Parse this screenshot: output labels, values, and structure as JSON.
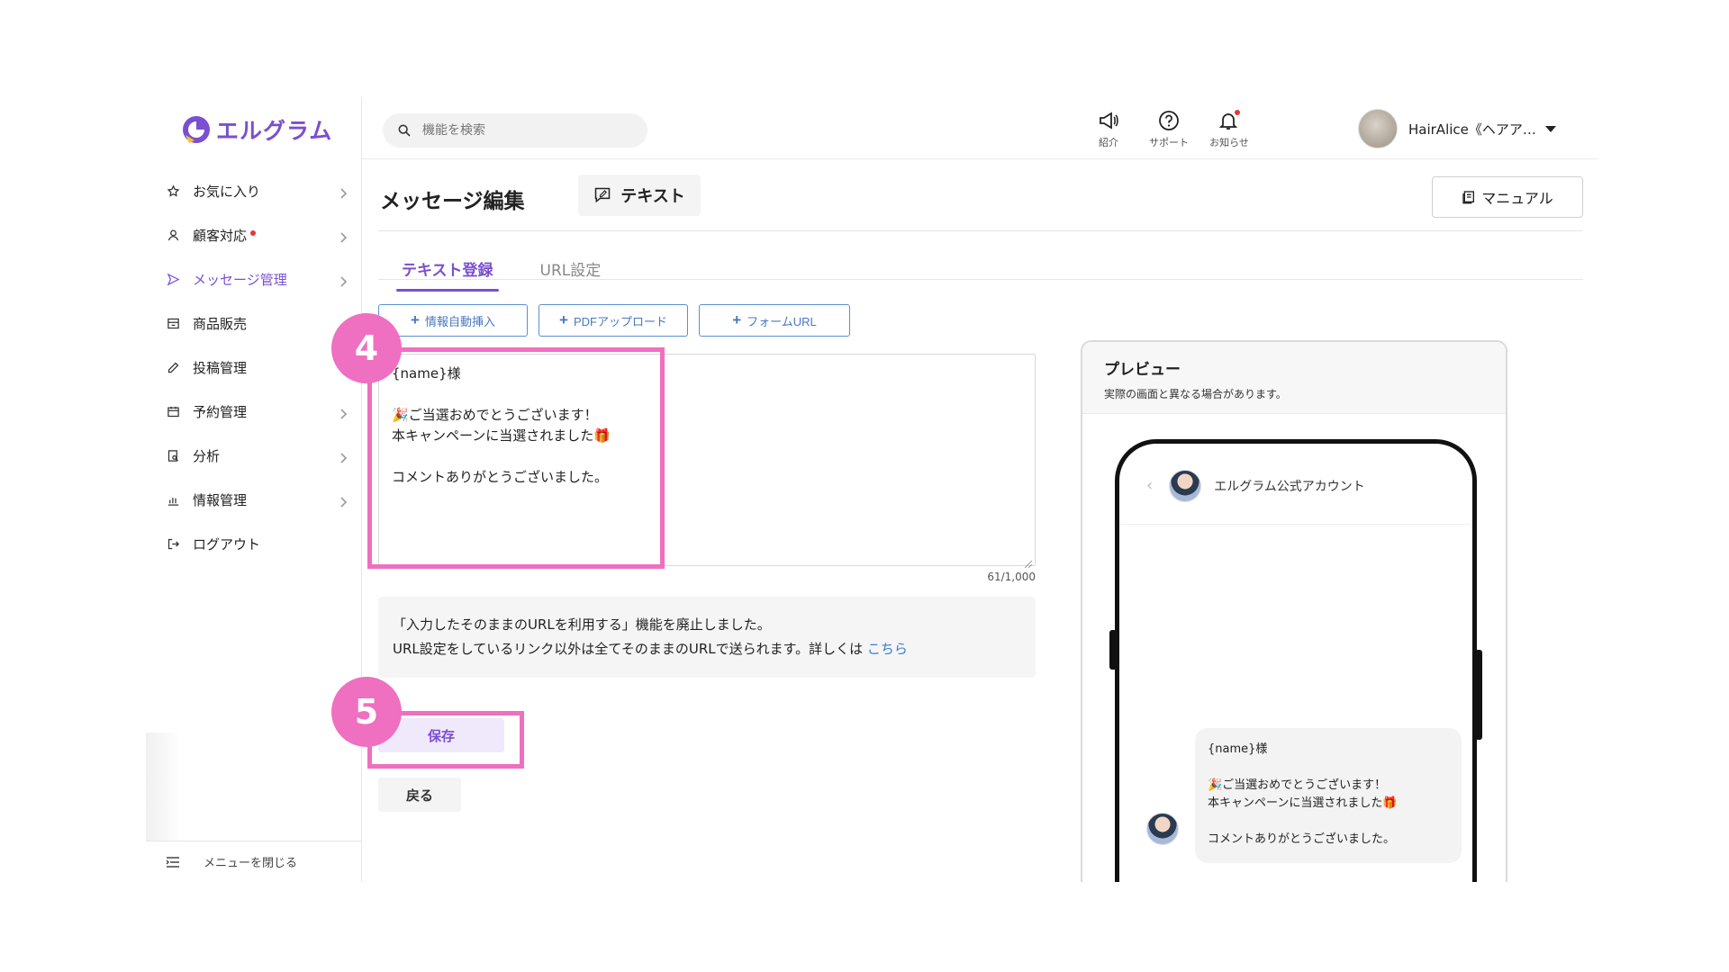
{
  "brand": {
    "name": "エルグラム"
  },
  "sidebar": {
    "items": [
      {
        "label": "お気に入り",
        "icon": "star-icon",
        "chevron": true
      },
      {
        "label": "顧客対応",
        "icon": "user-icon",
        "chevron": true,
        "alert_dot": true
      },
      {
        "label": "メッセージ管理",
        "icon": "send-icon",
        "chevron": true,
        "active": true
      },
      {
        "label": "商品販売",
        "icon": "store-icon",
        "chevron": false
      },
      {
        "label": "投稿管理",
        "icon": "edit-icon",
        "chevron": false
      },
      {
        "label": "予約管理",
        "icon": "calendar-icon",
        "chevron": true
      },
      {
        "label": "分析",
        "icon": "analysis-icon",
        "chevron": true
      },
      {
        "label": "情報管理",
        "icon": "bar-chart-icon",
        "chevron": true
      },
      {
        "label": "ログアウト",
        "icon": "logout-icon",
        "chevron": false
      }
    ],
    "close_menu_label": "メニューを閉じる"
  },
  "header": {
    "search_placeholder": "機能を検索",
    "icons": [
      {
        "label": "紹介",
        "icon": "megaphone-icon"
      },
      {
        "label": "サポート",
        "icon": "help-icon"
      },
      {
        "label": "お知らせ",
        "icon": "bell-icon",
        "alert_dot": true
      }
    ],
    "user_name": "HairAlice《ヘアア…"
  },
  "page": {
    "title": "メッセージ編集",
    "type_label": "テキスト",
    "manual_label": "マニュアル"
  },
  "tabs": [
    {
      "label": "テキスト登録",
      "active": true
    },
    {
      "label": "URL設定",
      "active": false
    }
  ],
  "insert_buttons": [
    {
      "label": "情報自動挿入"
    },
    {
      "label": "PDFアップロード"
    },
    {
      "label": "フォームURL"
    }
  ],
  "editor": {
    "lines": [
      "{name}様",
      "",
      "🎉ご当選おめでとうございます！",
      "本キャンペーンに当選されました🎁",
      "",
      "コメントありがとうございました。"
    ],
    "counter": "61/1,000"
  },
  "notice": {
    "line1": "「入力したそのままのURLを利用する」機能を廃止しました。",
    "line2": "URL設定をしているリンク以外は全てそのままのURLで送られます。詳しくは",
    "link": "こちら"
  },
  "actions": {
    "save_label": "保存",
    "back_label": "戻る"
  },
  "annotations": {
    "step4": "4",
    "step5": "5"
  },
  "preview": {
    "title": "プレビュー",
    "subtitle": "実際の画面と異なる場合があります。",
    "account_name": "エルグラム公式アカウント",
    "back_glyph": "‹"
  },
  "colors": {
    "accent": "#7a4fd0",
    "highlight": "#ef6fc0",
    "link": "#3b7bd6"
  }
}
